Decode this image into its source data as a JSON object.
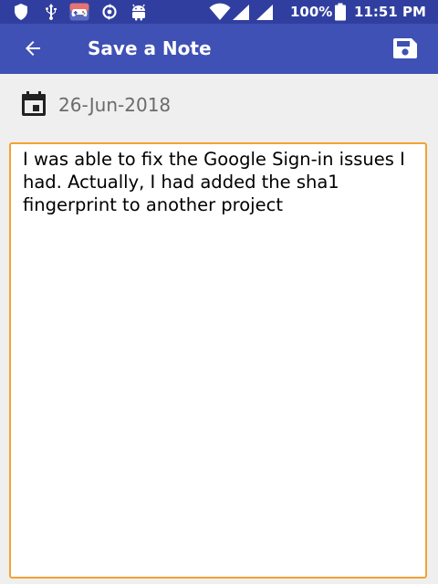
{
  "status_bar": {
    "battery_text": "100%",
    "clock": "11:51 PM",
    "left_icons": [
      "shield-icon",
      "usb-icon",
      "game-app-icon",
      "sync-icon",
      "android-icon"
    ],
    "right_icons": [
      "wifi-icon",
      "cell-signal-icon",
      "cell-signal-icon",
      "battery-icon"
    ]
  },
  "app_bar": {
    "title": "Save a Note",
    "nav_icon": "arrow-back-icon",
    "action_icon": "save-floppy-icon"
  },
  "date_row": {
    "icon": "calendar-icon",
    "date": "26-Jun-2018"
  },
  "note": {
    "text": "I was able to fix the Google Sign-in issues I had. Actually, I had added the sha1 fingerprint to another project"
  },
  "colors": {
    "status_bar": "#303f9f",
    "app_bar": "#3f51b5",
    "background": "#efefef",
    "note_border": "#f4a233",
    "date_text": "#6b6b6b"
  }
}
